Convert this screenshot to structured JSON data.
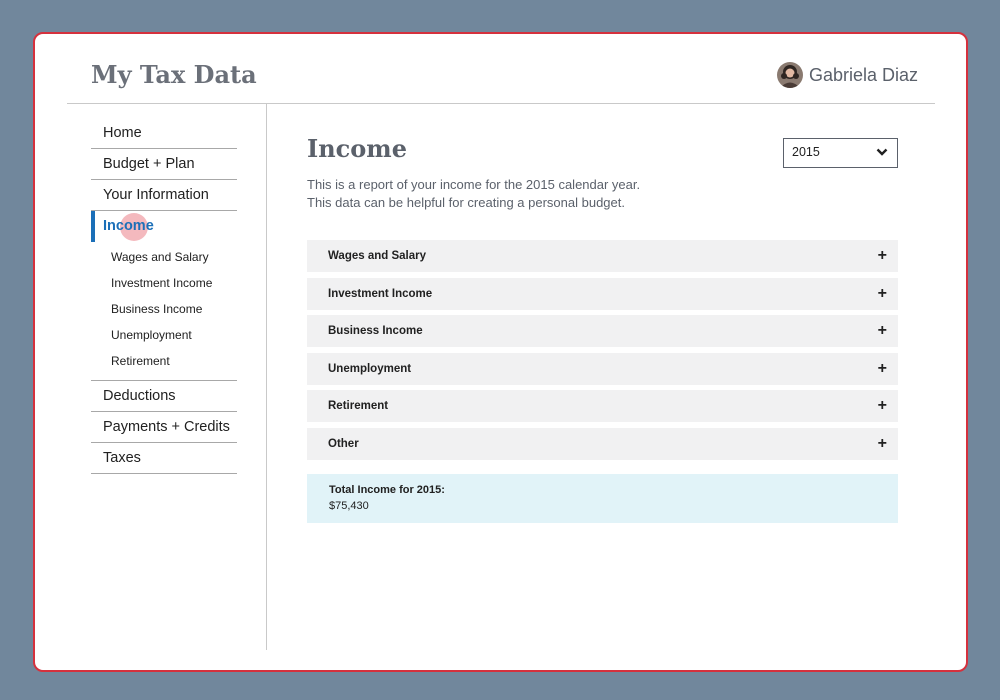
{
  "header": {
    "app_title": "My Tax Data",
    "user_name": "Gabriela Diaz"
  },
  "sidebar": {
    "items_top": [
      {
        "label": "Home"
      },
      {
        "label": "Budget + Plan"
      },
      {
        "label": "Your Information"
      }
    ],
    "active_item": {
      "label": "Income"
    },
    "sub_items": [
      {
        "label": "Wages and Salary"
      },
      {
        "label": "Investment Income"
      },
      {
        "label": "Business Income"
      },
      {
        "label": "Unemployment"
      },
      {
        "label": "Retirement"
      }
    ],
    "items_bottom": [
      {
        "label": "Deductions"
      },
      {
        "label": "Payments + Credits"
      },
      {
        "label": "Taxes"
      }
    ]
  },
  "main": {
    "title": "Income",
    "intro_line1": "This is a report of your income for the 2015 calendar year.",
    "intro_line2": "This data can be helpful for creating a personal budget.",
    "year_select": {
      "value": "2015"
    },
    "accordion": [
      {
        "label": "Wages and Salary",
        "icon": "plus-icon"
      },
      {
        "label": "Investment Income",
        "icon": "plus-icon"
      },
      {
        "label": "Business Income",
        "icon": "plus-icon"
      },
      {
        "label": "Unemployment",
        "icon": "plus-icon"
      },
      {
        "label": "Retirement",
        "icon": "plus-icon"
      },
      {
        "label": "Other",
        "icon": "plus-icon"
      }
    ],
    "total": {
      "label": "Total Income for 2015:",
      "value": "$75,430"
    }
  },
  "colors": {
    "background": "#71879c",
    "window_border": "#d5313d",
    "accent": "#1b6fb8",
    "accordion_bg": "#f1f1f2",
    "total_bg": "#e1f3f8"
  }
}
